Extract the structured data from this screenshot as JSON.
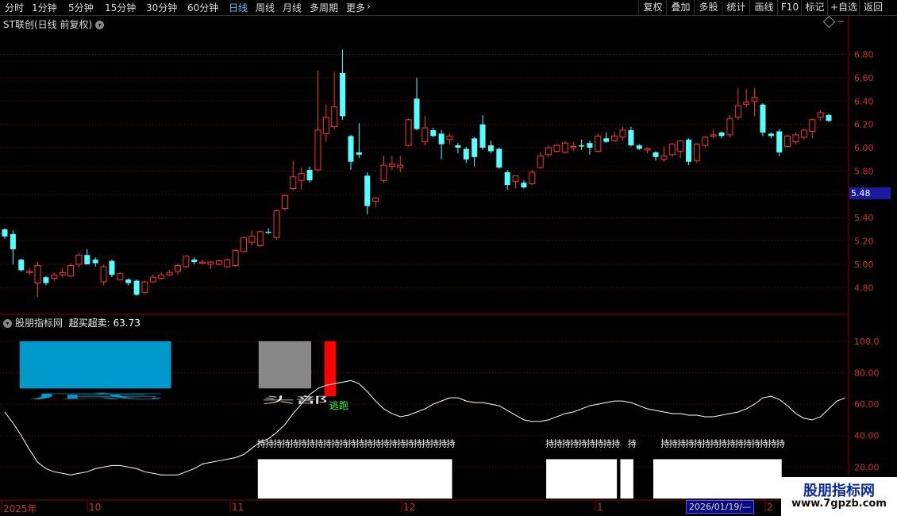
{
  "toolbar": {
    "periods": [
      "分时",
      "1分钟",
      "5分钟",
      "15分钟",
      "30分钟",
      "60分钟",
      "日线",
      "周线",
      "月线",
      "多周期",
      "更多"
    ],
    "active_period": "日线",
    "more_chevron": "›",
    "right_buttons": [
      "复权",
      "叠加",
      "多股",
      "统计",
      "画线",
      "F10",
      "标记",
      "+自选",
      "返回"
    ]
  },
  "chart_title": {
    "stock": "ST联创(日线 前复权)",
    "dropdown_icon": "chevron-down-icon"
  },
  "price_axis": {
    "ticks": [
      "6.80",
      "6.60",
      "6.40",
      "6.20",
      "6.00",
      "5.80",
      "5.60",
      "5.40",
      "5.20",
      "5.00",
      "4.80"
    ],
    "ylim": [
      4.66,
      6.98
    ],
    "current_price_tag": "5.48"
  },
  "indicator": {
    "title": "股朋指标网",
    "name": "超买超卖",
    "value": "63.73",
    "ticks": [
      "100.0",
      "80.00",
      "60.00",
      "40.00",
      "20.00"
    ],
    "ylim": [
      0,
      110
    ],
    "text_head": "头部",
    "text_escape": "逃跑",
    "text_hold": "持",
    "text_bottom_marks": "底"
  },
  "date_axis": {
    "labels": [
      "2025年",
      "10",
      "11",
      "12",
      "1",
      "2"
    ],
    "cursor_date": "2026/01/19/—"
  },
  "logo": {
    "main": "股朋指标网",
    "url": "www.7gpzb.com"
  },
  "colors": {
    "up": "#ff3333",
    "down": "#54ffff",
    "grid": "#8b0000",
    "axis_text": "#d03030",
    "overbought_box": "#0099cc",
    "gray_box": "#888888",
    "escape_bar": "#ff0000"
  },
  "chart_data": {
    "type": "candlestick",
    "candles": [
      {
        "o": 5.3,
        "h": 5.31,
        "l": 5.22,
        "c": 5.24
      },
      {
        "o": 5.26,
        "h": 5.29,
        "l": 5.0,
        "c": 5.13
      },
      {
        "o": 5.04,
        "h": 5.05,
        "l": 4.94,
        "c": 4.95
      },
      {
        "o": 4.93,
        "h": 4.97,
        "l": 4.91,
        "c": 4.94
      },
      {
        "o": 4.84,
        "h": 5.02,
        "l": 4.72,
        "c": 4.99
      },
      {
        "o": 4.89,
        "h": 4.9,
        "l": 4.82,
        "c": 4.84
      },
      {
        "o": 4.88,
        "h": 4.93,
        "l": 4.86,
        "c": 4.91
      },
      {
        "o": 4.91,
        "h": 4.97,
        "l": 4.89,
        "c": 4.93
      },
      {
        "o": 4.9,
        "h": 5.01,
        "l": 4.89,
        "c": 4.99
      },
      {
        "o": 5.0,
        "h": 5.1,
        "l": 4.97,
        "c": 5.08
      },
      {
        "o": 5.08,
        "h": 5.13,
        "l": 5.0,
        "c": 5.0
      },
      {
        "o": 5.04,
        "h": 5.06,
        "l": 4.98,
        "c": 5.01
      },
      {
        "o": 4.85,
        "h": 5.0,
        "l": 4.82,
        "c": 4.98
      },
      {
        "o": 5.03,
        "h": 5.04,
        "l": 4.89,
        "c": 4.91
      },
      {
        "o": 4.87,
        "h": 4.93,
        "l": 4.86,
        "c": 4.92
      },
      {
        "o": 4.87,
        "h": 4.88,
        "l": 4.82,
        "c": 4.84
      },
      {
        "o": 4.86,
        "h": 4.87,
        "l": 4.73,
        "c": 4.74
      },
      {
        "o": 4.76,
        "h": 4.86,
        "l": 4.75,
        "c": 4.85
      },
      {
        "o": 4.85,
        "h": 4.91,
        "l": 4.84,
        "c": 4.89
      },
      {
        "o": 4.88,
        "h": 4.93,
        "l": 4.87,
        "c": 4.91
      },
      {
        "o": 4.91,
        "h": 4.95,
        "l": 4.9,
        "c": 4.93
      },
      {
        "o": 4.94,
        "h": 5.01,
        "l": 4.91,
        "c": 4.99
      },
      {
        "o": 4.98,
        "h": 5.08,
        "l": 4.97,
        "c": 5.07
      },
      {
        "o": 5.04,
        "h": 5.06,
        "l": 5.0,
        "c": 5.02
      },
      {
        "o": 5.01,
        "h": 5.04,
        "l": 5.0,
        "c": 5.02
      },
      {
        "o": 5.0,
        "h": 5.03,
        "l": 4.96,
        "c": 5.02
      },
      {
        "o": 5.0,
        "h": 5.04,
        "l": 4.99,
        "c": 5.03
      },
      {
        "o": 4.98,
        "h": 5.05,
        "l": 4.97,
        "c": 5.04
      },
      {
        "o": 4.99,
        "h": 5.13,
        "l": 4.98,
        "c": 5.12
      },
      {
        "o": 5.11,
        "h": 5.24,
        "l": 5.1,
        "c": 5.23
      },
      {
        "o": 5.19,
        "h": 5.29,
        "l": 5.16,
        "c": 5.24
      },
      {
        "o": 5.16,
        "h": 5.29,
        "l": 5.15,
        "c": 5.28
      },
      {
        "o": 5.28,
        "h": 5.31,
        "l": 5.26,
        "c": 5.27
      },
      {
        "o": 5.23,
        "h": 5.47,
        "l": 5.21,
        "c": 5.46
      },
      {
        "o": 5.48,
        "h": 5.6,
        "l": 5.46,
        "c": 5.59
      },
      {
        "o": 5.65,
        "h": 5.89,
        "l": 5.63,
        "c": 5.75
      },
      {
        "o": 5.72,
        "h": 5.83,
        "l": 5.64,
        "c": 5.78
      },
      {
        "o": 5.81,
        "h": 5.84,
        "l": 5.7,
        "c": 5.72
      },
      {
        "o": 5.81,
        "h": 6.66,
        "l": 5.79,
        "c": 6.15
      },
      {
        "o": 6.12,
        "h": 6.37,
        "l": 6.05,
        "c": 6.26
      },
      {
        "o": 6.18,
        "h": 6.65,
        "l": 6.16,
        "c": 6.35
      },
      {
        "o": 6.64,
        "h": 6.84,
        "l": 6.24,
        "c": 6.27
      },
      {
        "o": 6.1,
        "h": 6.11,
        "l": 5.81,
        "c": 5.88
      },
      {
        "o": 5.96,
        "h": 6.21,
        "l": 5.91,
        "c": 5.94
      },
      {
        "o": 5.76,
        "h": 5.79,
        "l": 5.43,
        "c": 5.5
      },
      {
        "o": 5.54,
        "h": 5.58,
        "l": 5.49,
        "c": 5.57
      },
      {
        "o": 5.72,
        "h": 5.93,
        "l": 5.7,
        "c": 5.85
      },
      {
        "o": 5.84,
        "h": 5.93,
        "l": 5.81,
        "c": 5.86
      },
      {
        "o": 5.83,
        "h": 5.93,
        "l": 5.79,
        "c": 5.85
      },
      {
        "o": 6.02,
        "h": 6.25,
        "l": 6.01,
        "c": 6.24
      },
      {
        "o": 6.42,
        "h": 6.6,
        "l": 6.15,
        "c": 6.16
      },
      {
        "o": 6.05,
        "h": 6.27,
        "l": 6.02,
        "c": 6.17
      },
      {
        "o": 6.15,
        "h": 6.17,
        "l": 6.09,
        "c": 6.1
      },
      {
        "o": 6.12,
        "h": 6.15,
        "l": 5.9,
        "c": 6.03
      },
      {
        "o": 6.07,
        "h": 6.12,
        "l": 6.03,
        "c": 6.1
      },
      {
        "o": 6.02,
        "h": 6.04,
        "l": 5.95,
        "c": 6.0
      },
      {
        "o": 5.99,
        "h": 6.01,
        "l": 5.87,
        "c": 5.9
      },
      {
        "o": 6.08,
        "h": 6.09,
        "l": 5.84,
        "c": 5.92
      },
      {
        "o": 6.2,
        "h": 6.28,
        "l": 5.98,
        "c": 6.0
      },
      {
        "o": 6.02,
        "h": 6.06,
        "l": 5.95,
        "c": 5.97
      },
      {
        "o": 5.99,
        "h": 6.0,
        "l": 5.82,
        "c": 5.83
      },
      {
        "o": 5.79,
        "h": 5.81,
        "l": 5.64,
        "c": 5.68
      },
      {
        "o": 5.71,
        "h": 5.76,
        "l": 5.65,
        "c": 5.76
      },
      {
        "o": 5.7,
        "h": 5.72,
        "l": 5.65,
        "c": 5.66
      },
      {
        "o": 5.69,
        "h": 5.81,
        "l": 5.68,
        "c": 5.79
      },
      {
        "o": 5.83,
        "h": 5.96,
        "l": 5.82,
        "c": 5.93
      },
      {
        "o": 5.94,
        "h": 6.02,
        "l": 5.92,
        "c": 6.0
      },
      {
        "o": 5.97,
        "h": 6.03,
        "l": 5.96,
        "c": 6.02
      },
      {
        "o": 5.96,
        "h": 6.06,
        "l": 5.95,
        "c": 6.04
      },
      {
        "o": 6.0,
        "h": 6.05,
        "l": 5.97,
        "c": 6.01
      },
      {
        "o": 6.02,
        "h": 6.07,
        "l": 5.98,
        "c": 6.01
      },
      {
        "o": 6.04,
        "h": 6.06,
        "l": 5.94,
        "c": 6.0
      },
      {
        "o": 5.97,
        "h": 6.12,
        "l": 5.96,
        "c": 6.1
      },
      {
        "o": 6.08,
        "h": 6.13,
        "l": 6.04,
        "c": 6.05
      },
      {
        "o": 6.06,
        "h": 6.14,
        "l": 6.05,
        "c": 6.1
      },
      {
        "o": 6.09,
        "h": 6.18,
        "l": 6.06,
        "c": 6.15
      },
      {
        "o": 6.15,
        "h": 6.18,
        "l": 6.01,
        "c": 6.02
      },
      {
        "o": 6.02,
        "h": 6.03,
        "l": 5.98,
        "c": 5.99
      },
      {
        "o": 5.98,
        "h": 6.0,
        "l": 5.95,
        "c": 5.99
      },
      {
        "o": 5.96,
        "h": 5.97,
        "l": 5.89,
        "c": 5.92
      },
      {
        "o": 5.9,
        "h": 6.01,
        "l": 5.88,
        "c": 5.93
      },
      {
        "o": 5.94,
        "h": 6.04,
        "l": 5.92,
        "c": 6.03
      },
      {
        "o": 5.97,
        "h": 6.07,
        "l": 5.91,
        "c": 6.06
      },
      {
        "o": 6.07,
        "h": 6.08,
        "l": 5.85,
        "c": 5.88
      },
      {
        "o": 5.89,
        "h": 6.04,
        "l": 5.87,
        "c": 6.03
      },
      {
        "o": 6.02,
        "h": 6.1,
        "l": 6.0,
        "c": 6.09
      },
      {
        "o": 6.1,
        "h": 6.16,
        "l": 6.08,
        "c": 6.11
      },
      {
        "o": 6.13,
        "h": 6.14,
        "l": 6.08,
        "c": 6.1
      },
      {
        "o": 6.11,
        "h": 6.28,
        "l": 6.09,
        "c": 6.25
      },
      {
        "o": 6.26,
        "h": 6.51,
        "l": 6.24,
        "c": 6.36
      },
      {
        "o": 6.37,
        "h": 6.5,
        "l": 6.35,
        "c": 6.39
      },
      {
        "o": 6.4,
        "h": 6.51,
        "l": 6.27,
        "c": 6.43
      },
      {
        "o": 6.37,
        "h": 6.38,
        "l": 6.1,
        "c": 6.13
      },
      {
        "o": 6.12,
        "h": 6.13,
        "l": 6.08,
        "c": 6.1
      },
      {
        "o": 6.14,
        "h": 6.16,
        "l": 5.93,
        "c": 5.96
      },
      {
        "o": 6.01,
        "h": 6.11,
        "l": 6.0,
        "c": 6.1
      },
      {
        "o": 6.05,
        "h": 6.13,
        "l": 6.03,
        "c": 6.11
      },
      {
        "o": 6.09,
        "h": 6.16,
        "l": 6.07,
        "c": 6.15
      },
      {
        "o": 6.14,
        "h": 6.25,
        "l": 6.08,
        "c": 6.24
      },
      {
        "o": 6.26,
        "h": 6.32,
        "l": 6.23,
        "c": 6.3
      },
      {
        "o": 6.28,
        "h": 6.29,
        "l": 6.22,
        "c": 6.23
      }
    ],
    "indicator_line": [
      55,
      48,
      40,
      31,
      23,
      19,
      17,
      16,
      15,
      16,
      17,
      19,
      20,
      21,
      21,
      20,
      19,
      17,
      16,
      15,
      15,
      15,
      17,
      19,
      22,
      23,
      24,
      25,
      26,
      28,
      32,
      36,
      38,
      42,
      47,
      54,
      60,
      66,
      70,
      72,
      73,
      74,
      75,
      73,
      68,
      62,
      57,
      54,
      52,
      53,
      55,
      57,
      60,
      62,
      64,
      64,
      62,
      61,
      61,
      60,
      59,
      56,
      53,
      50,
      49,
      49,
      50,
      52,
      54,
      55,
      57,
      59,
      60,
      61,
      62,
      62,
      61,
      59,
      57,
      56,
      55,
      54,
      54,
      53,
      53,
      52,
      52,
      53,
      54,
      55,
      57,
      60,
      64,
      65,
      63,
      59,
      54,
      51,
      50,
      52,
      57,
      62,
      64
    ],
    "overbought_boxes": [
      {
        "from_idx": 2,
        "to_idx": 20,
        "top": 100,
        "bottom": 70,
        "kind": "blue"
      },
      {
        "from_idx": 31,
        "to_idx": 37,
        "top": 100,
        "bottom": 70,
        "kind": "gray"
      },
      {
        "from_idx": 39,
        "to_idx": 40,
        "top": 100,
        "bottom": 65,
        "kind": "red"
      }
    ],
    "hold_segments": [
      {
        "from_idx": 31,
        "to_idx": 54
      },
      {
        "from_idx": 66,
        "to_idx": 74
      },
      {
        "from_idx": 76,
        "to_idx": 76
      },
      {
        "from_idx": 80,
        "to_idx": 94
      }
    ],
    "bottom_blocks": [
      {
        "from_idx": 31,
        "to_idx": 54
      },
      {
        "from_idx": 66,
        "to_idx": 74
      },
      {
        "from_idx": 75,
        "to_idx": 76
      },
      {
        "from_idx": 79,
        "to_idx": 94
      }
    ]
  }
}
